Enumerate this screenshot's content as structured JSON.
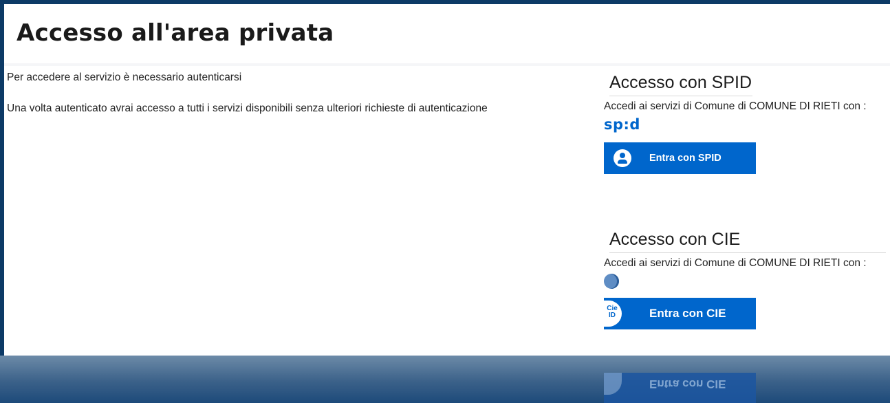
{
  "page": {
    "title": "Accesso all'area privata",
    "intro_line_1": "Per accedere al servizio è necessario autenticarsi",
    "intro_line_2": "Una volta autenticato avrai accesso a tutti i servizi disponibili senza ulteriori richieste di autenticazione"
  },
  "spid": {
    "heading": "Accesso con SPID",
    "description": "Accedi ai servizi di Comune di COMUNE DI RIETI con :",
    "logo_text": "sp:d",
    "button_label": "Entra con SPID",
    "button_color": "#0066cc"
  },
  "cie": {
    "heading": "Accesso con CIE",
    "description": "Accedi ai servizi di Comune di COMUNE DI RIETI con :",
    "icon_text": "Cie ID",
    "button_label": "Entra con CIE",
    "button_color": "#0066cc"
  },
  "reflection": {
    "button_label": "Entra con CIE"
  },
  "colors": {
    "frame_background": "#0d3a66",
    "accent": "#0066cc"
  }
}
